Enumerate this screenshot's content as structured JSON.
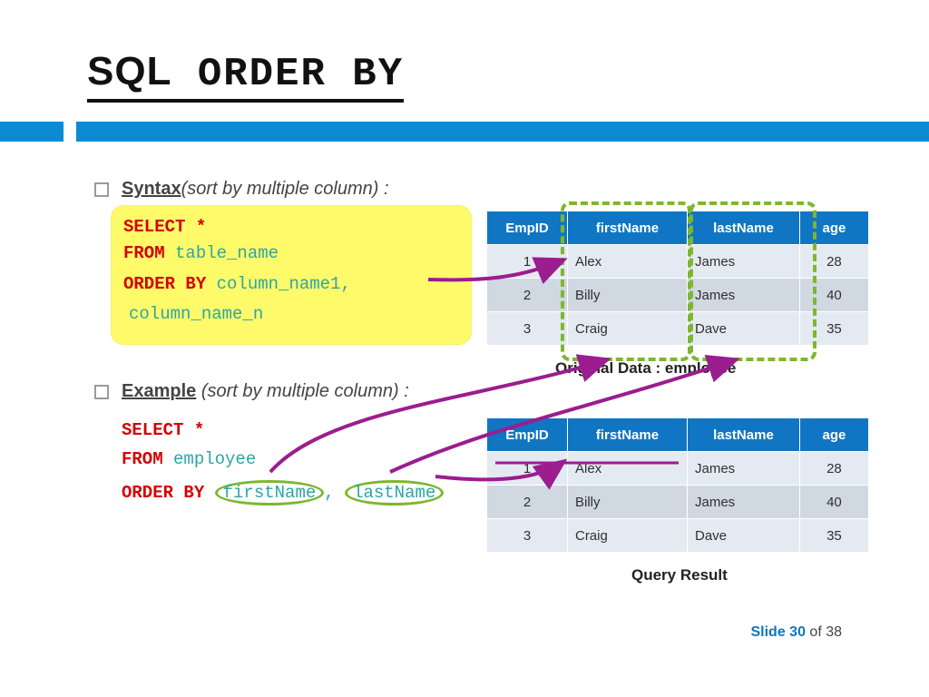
{
  "title": {
    "prefix": "SQL",
    "rest": " ORDER BY"
  },
  "bullets": {
    "syntax": {
      "u": "Syntax",
      "rest": "(sort by multiple column) :"
    },
    "example": {
      "u": "Example",
      "rest": " (sort by multiple column) :"
    }
  },
  "syntax_code": {
    "l1a": "SELECT",
    "l1b": " *",
    "l2a": "FROM",
    "l2b": "table_name",
    "l3a": "ORDER BY",
    "l3b": "column_name1,",
    "l4": "column_name_n"
  },
  "example_code": {
    "l1a": "SELECT",
    "l1b": " *",
    "l2a": "FROM",
    "l2b": "employee",
    "l3a": "ORDER BY",
    "l3b": "firstName",
    "l3c": ", ",
    "l3d": "lastName"
  },
  "table": {
    "headers": {
      "emp": "EmpID",
      "first": "firstName",
      "last": "lastName",
      "age": "age"
    },
    "orig": [
      {
        "emp": "1",
        "first": "Alex",
        "last": "James",
        "age": "28"
      },
      {
        "emp": "2",
        "first": "Billy",
        "last": "James",
        "age": "40"
      },
      {
        "emp": "3",
        "first": "Craig",
        "last": "Dave",
        "age": "35"
      }
    ],
    "result": [
      {
        "emp": "1",
        "first": "Alex",
        "last": "James",
        "age": "28"
      },
      {
        "emp": "2",
        "first": "Billy",
        "last": "James",
        "age": "40"
      },
      {
        "emp": "3",
        "first": "Craig",
        "last": "Dave",
        "age": "35"
      }
    ]
  },
  "captions": {
    "orig": "Original Data : employee",
    "result": "Query Result"
  },
  "footer": {
    "slide": "Slide 30",
    "of": " of 38"
  }
}
